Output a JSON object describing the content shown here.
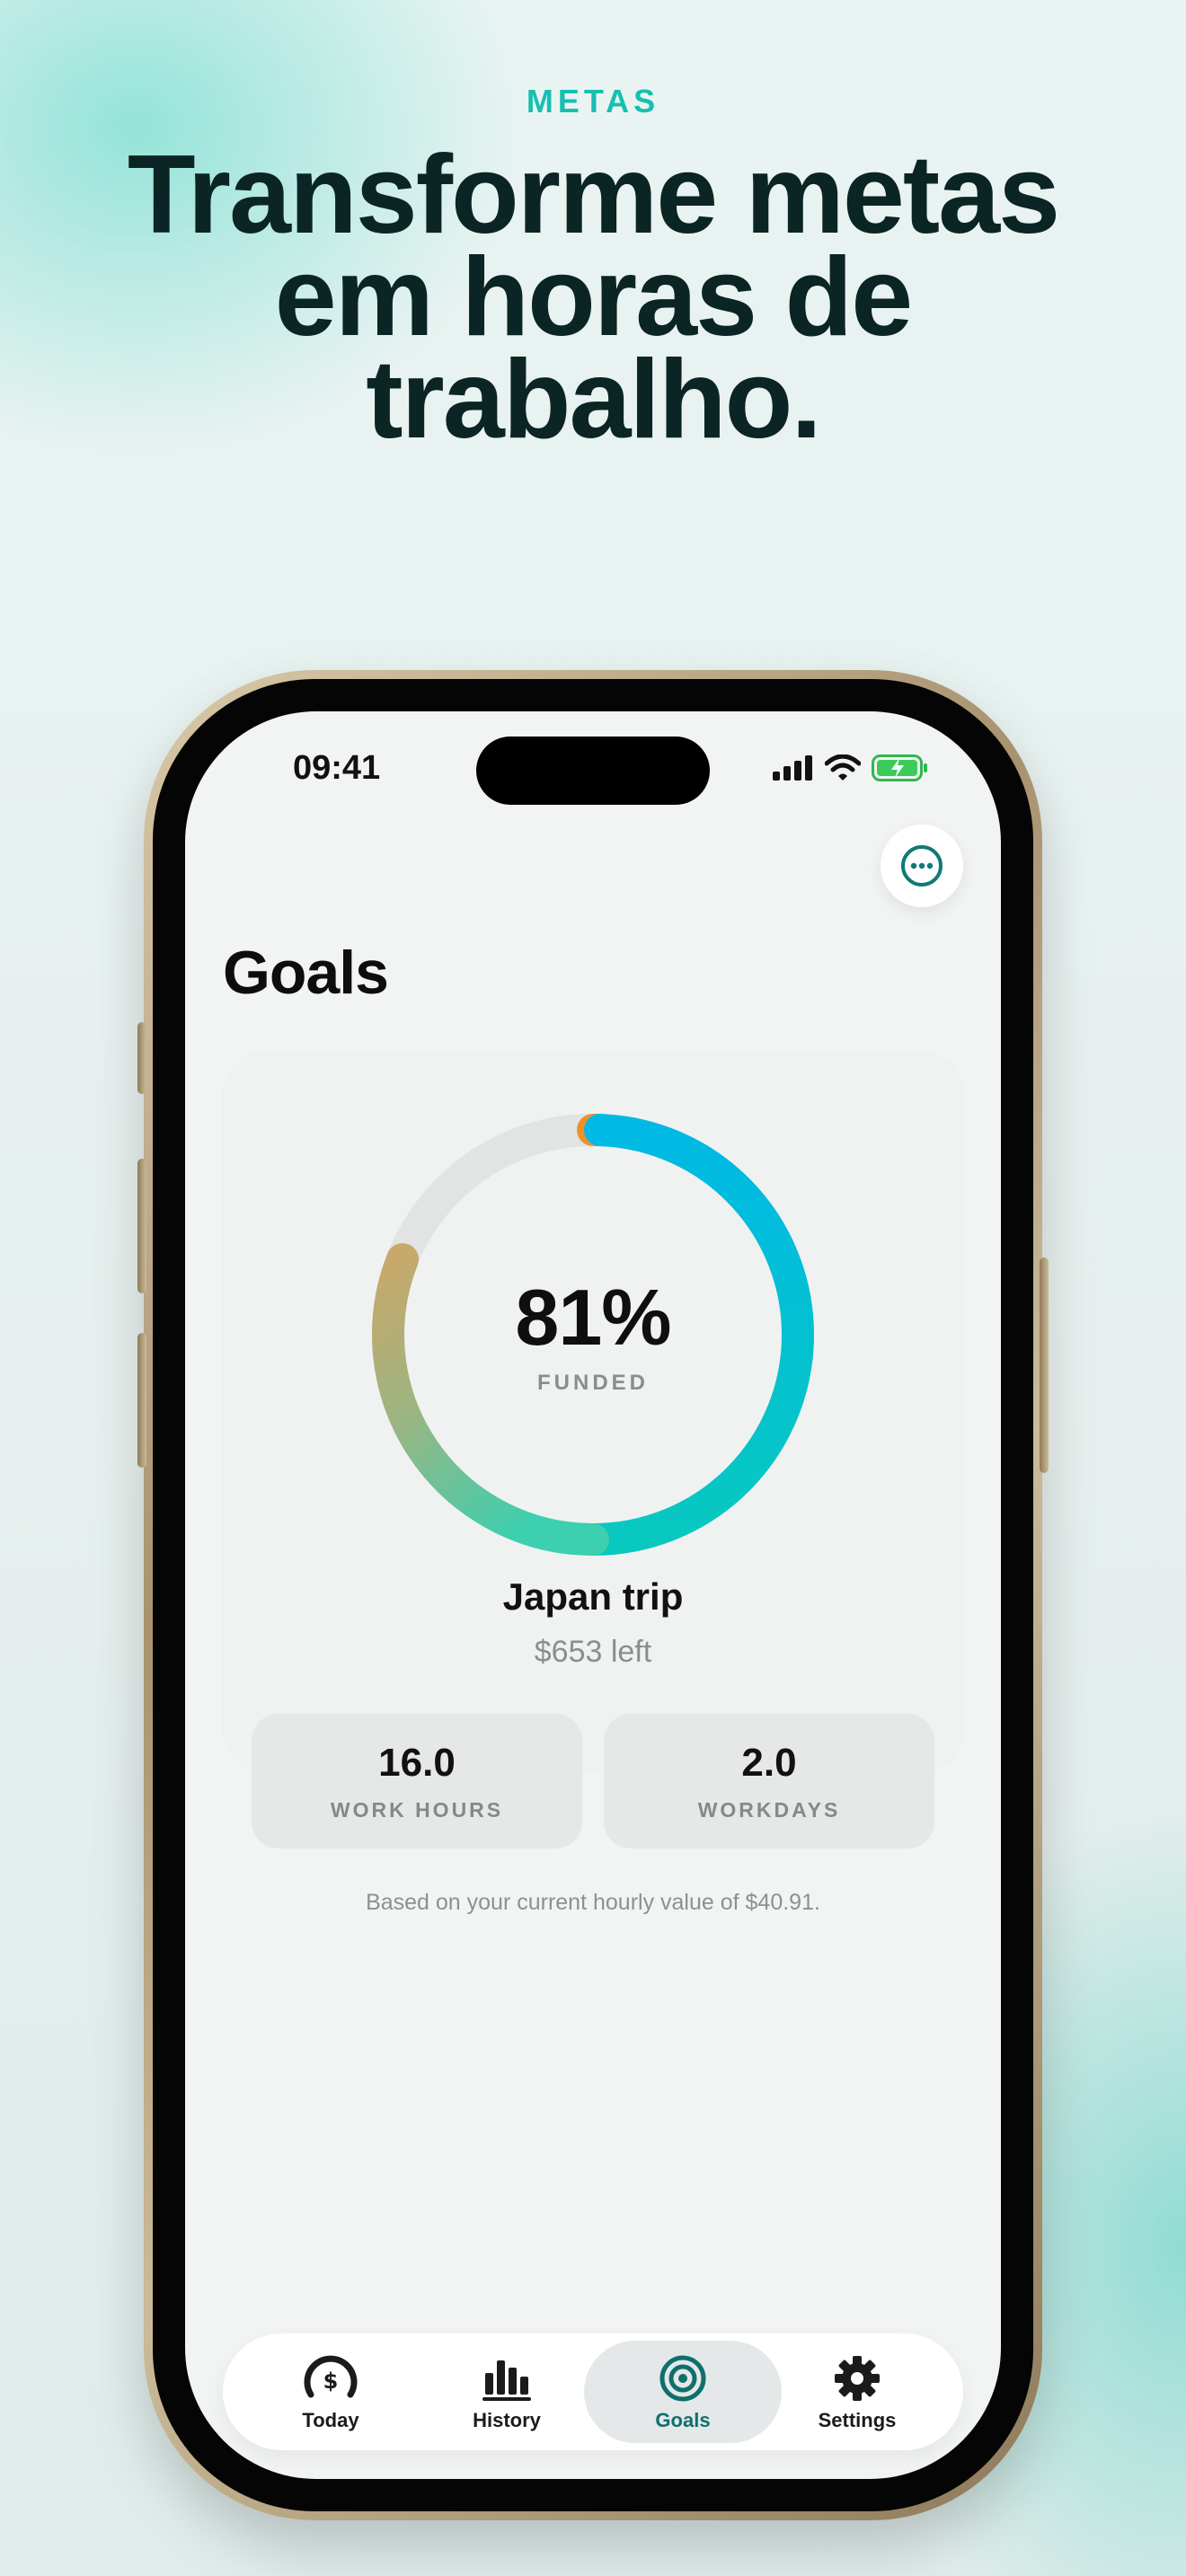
{
  "marketing": {
    "eyebrow": "METAS",
    "headline_line1": "Transforme metas",
    "headline_line2": "em horas de",
    "headline_line3": "trabalho."
  },
  "status_bar": {
    "time": "09:41"
  },
  "goals_screen": {
    "title": "Goals",
    "goal": {
      "progress_percent": 81,
      "percent_label": "81%",
      "caption": "FUNDED",
      "name": "Japan trip",
      "remaining": "$653 left"
    },
    "stats": [
      {
        "value": "16.0",
        "label": "WORK HOURS"
      },
      {
        "value": "2.0",
        "label": "WORKDAYS"
      }
    ],
    "footnote": "Based on your current hourly value of $40.91."
  },
  "tab_bar": {
    "active": "Goals",
    "tabs": [
      {
        "label": "Today",
        "icon": "gauge-dollar-icon"
      },
      {
        "label": "History",
        "icon": "bar-chart-icon"
      },
      {
        "label": "Goals",
        "icon": "target-icon"
      },
      {
        "label": "Settings",
        "icon": "gear-icon"
      }
    ]
  },
  "colors": {
    "accent": "#17bfb1",
    "headline": "#0b2424",
    "ring_start": "#c9a86a",
    "ring_mid": "#3ccfb0",
    "ring_end": "#00b9e4",
    "ring_track": "#e2e4e4",
    "ring_marker": "#f0902c",
    "active_tab": "#0f6f6d"
  }
}
